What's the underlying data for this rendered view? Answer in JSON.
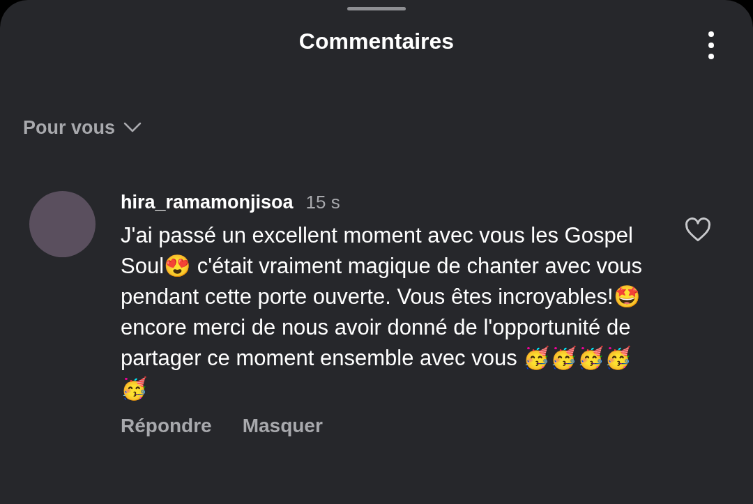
{
  "header": {
    "title": "Commentaires"
  },
  "sort": {
    "label": "Pour vous"
  },
  "comments": [
    {
      "username": "hira_ramamonjisoa",
      "time": "15 s",
      "text": "J'ai passé un excellent moment avec vous les Gospel Soul😍 c'était vraiment magique de chanter avec vous pendant cette porte ouverte. Vous êtes incroyables!🤩 encore merci de nous avoir donné de l'opportunité de partager ce moment ensemble avec vous 🥳🥳🥳🥳🥳",
      "liked": false,
      "actions": [
        "Répondre",
        "Masquer"
      ]
    }
  ]
}
